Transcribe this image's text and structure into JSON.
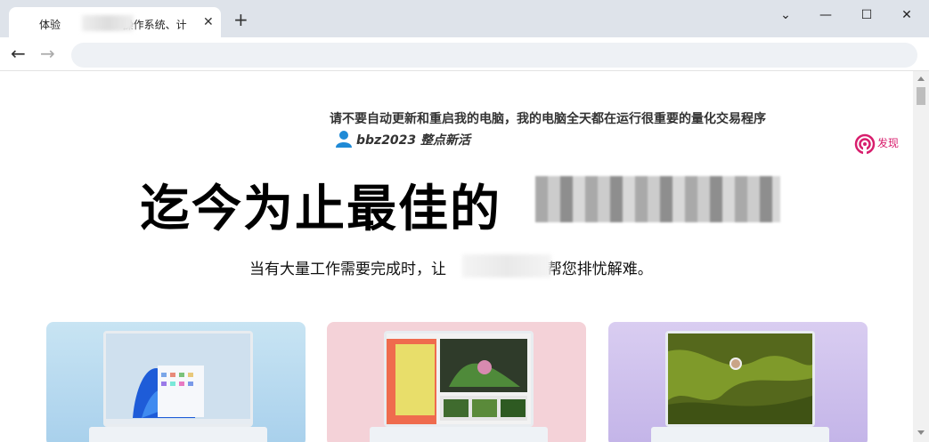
{
  "browser": {
    "tab_title_prefix": "体验",
    "tab_title_suffix": "操作系统、计",
    "close_glyph": "✕",
    "newtab_glyph": "+",
    "back_glyph": "←",
    "forward_glyph": "→",
    "window_controls": [
      "⌄",
      "—",
      "☐",
      "✕"
    ]
  },
  "page": {
    "notice": "请不要自动更新和重启我的电脑，我的电脑全天都在运行很重要的量化交易程序",
    "user_meta": "bbz2023 整点新活",
    "discover_label": "发现",
    "hero_heading": "迄今为止最佳的",
    "subtitle_prefix": "当有大量工作需要完成时，让",
    "subtitle_suffix": "帮您排忧解难。"
  },
  "colors": {
    "titlebar": "#dee3ea",
    "discover_accent": "#d81e6d",
    "user_icon": "#1f8ad6"
  },
  "icons": {
    "user": "user-icon",
    "discover": "discover-icon"
  }
}
